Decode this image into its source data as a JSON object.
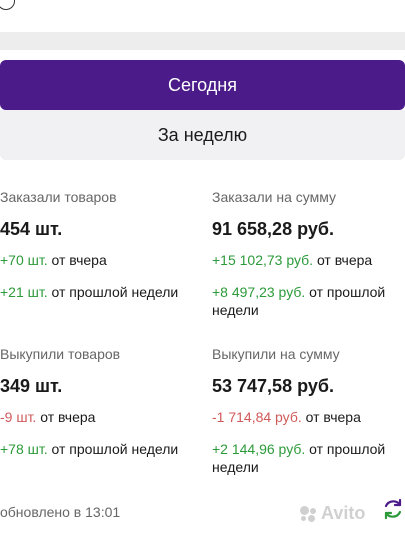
{
  "tabs": {
    "today": "Сегодня",
    "week": "За неделю"
  },
  "stats": {
    "ordered_items": {
      "label": "Заказали товаров",
      "value": "454 шт.",
      "vs_yesterday_value": "+70 шт.",
      "vs_yesterday_text": "от вчера",
      "vs_last_week_value": "+21 шт.",
      "vs_last_week_text": "от прошлой недели"
    },
    "ordered_sum": {
      "label": "Заказали на сумму",
      "value": "91 658,28 руб.",
      "vs_yesterday_value": "+15 102,73 руб.",
      "vs_yesterday_text": "от вчера",
      "vs_last_week_value": "+8 497,23 руб.",
      "vs_last_week_text": "от прошлой недели"
    },
    "bought_items": {
      "label": "Выкупили товаров",
      "value": "349 шт.",
      "vs_yesterday_value": "-9 шт.",
      "vs_yesterday_text": "от вчера",
      "vs_last_week_value": "+78 шт.",
      "vs_last_week_text": "от прошлой недели"
    },
    "bought_sum": {
      "label": "Выкупили на сумму",
      "value": "53 747,58 руб.",
      "vs_yesterday_value": "-1 714,84 руб.",
      "vs_yesterday_text": "от вчера",
      "vs_last_week_value": "+2 144,96 руб.",
      "vs_last_week_text": "от прошлой недели"
    }
  },
  "footer": {
    "updated": "обновлено в 13:01",
    "watermark": "Avito"
  },
  "colors": {
    "accent": "#4b1b8a",
    "positive": "#2c9a3a",
    "negative": "#d05a5a"
  },
  "icons": [
    "radio-circle-icon",
    "refresh-icon",
    "avito-logo-icon"
  ]
}
